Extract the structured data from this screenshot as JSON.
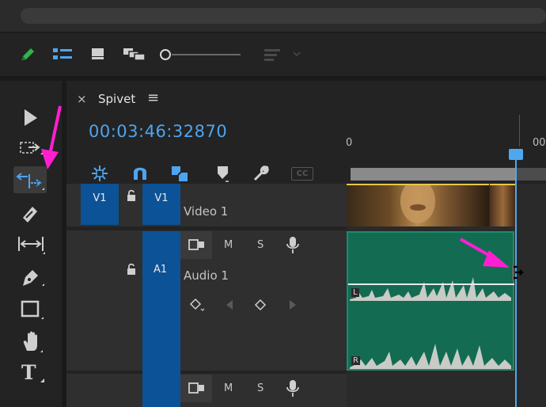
{
  "sequence": {
    "tab_close": "×",
    "tab_title": "Spivet",
    "tab_menu": "≡",
    "timecode": "00:03:46:32870"
  },
  "ruler": {
    "label_start": "0",
    "label_end": "00"
  },
  "tracks": {
    "video1": {
      "source_label": "V1",
      "target_label": "V1",
      "name": "Video 1"
    },
    "audio1": {
      "target_label": "A1",
      "name": "Audio 1",
      "mute": "M",
      "solo": "S",
      "left_channel": "L",
      "right_channel": "R"
    },
    "audio2": {
      "mute": "M",
      "solo": "S"
    }
  },
  "toolbar_icons": [
    "pencil-icon",
    "list-view-icon",
    "icon-view-icon",
    "freeform-view-icon",
    "zoom-slider",
    "sort-icon"
  ],
  "timeline_controls": [
    "nest-icon",
    "snap-icon",
    "linked-selection-icon",
    "add-marker-icon",
    "settings-wrench-icon",
    "captions-icon"
  ],
  "captions_label": "CC",
  "tools": [
    "selection-tool",
    "track-select-tool",
    "ripple-edit-tool",
    "razor-tool",
    "slip-tool",
    "pen-tool",
    "rectangle-tool",
    "hand-tool",
    "type-tool"
  ],
  "type_tool_label": "T",
  "colors": {
    "accent": "#4ea4f0",
    "track_target": "#0c5296",
    "audio_clip": "#136b52",
    "annotation_arrow": "#ff1fd1"
  }
}
